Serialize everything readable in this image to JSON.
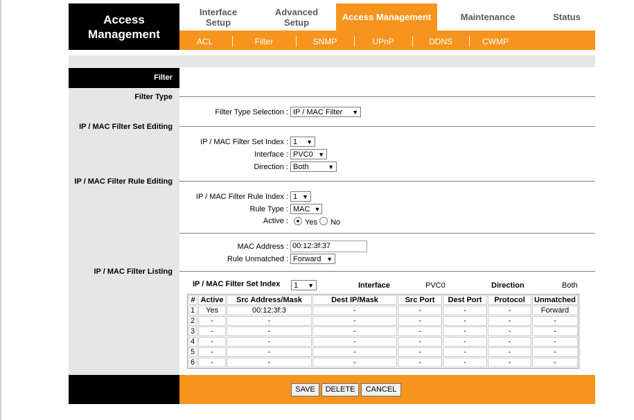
{
  "brand": {
    "line1": "Access",
    "line2": "Management"
  },
  "top_tabs": [
    {
      "line1": "Interface",
      "line2": "Setup"
    },
    {
      "line1": "Advanced",
      "line2": "Setup"
    },
    {
      "line1": "Access Management",
      "line2": ""
    },
    {
      "line1": "Maintenance",
      "line2": ""
    },
    {
      "line1": "Status",
      "line2": ""
    }
  ],
  "sub_tabs": [
    "ACL",
    "Filter",
    "SNMP",
    "UPnP",
    "DDNS",
    "CWMP"
  ],
  "left": {
    "header": "Filter",
    "filter_type": "Filter Type",
    "set_editing": "IP / MAC Filter Set Editing",
    "rule_editing": "IP / MAC Filter Rule Editing",
    "listing": "IP / MAC Filter Listing"
  },
  "form": {
    "filter_type_selection_label": "Filter Type Selection :",
    "filter_type_selection_value": "IP / MAC Filter",
    "set_index_label": "IP / MAC Filter Set Index :",
    "set_index_value": "1",
    "interface_label": "Interface :",
    "interface_value": "PVC0",
    "direction_label": "Direction :",
    "direction_value": "Both",
    "rule_index_label": "IP / MAC Filter Rule Index :",
    "rule_index_value": "1",
    "rule_type_label": "Rule Type :",
    "rule_type_value": "MAC",
    "active_label": "Active :",
    "active_yes": "Yes",
    "active_no": "No",
    "mac_label": "MAC Address :",
    "mac_value": "00:12:3f:37",
    "unmatched_label": "Rule Unmatched :",
    "unmatched_value": "Forward"
  },
  "listing": {
    "set_index_label": "IP / MAC Filter Set Index",
    "set_index_value": "1",
    "interface_label": "Interface",
    "interface_value": "PVC0",
    "direction_label": "Direction",
    "direction_value": "Both",
    "columns": [
      "#",
      "Active",
      "Src Address/Mask",
      "Dest IP/Mask",
      "Src Port",
      "Dest Port",
      "Protocol",
      "Unmatched"
    ],
    "rows": [
      [
        "1",
        "Yes",
        "00:12:3f:3",
        "-",
        "-",
        "-",
        "-",
        "Forward"
      ],
      [
        "2",
        "-",
        "-",
        "-",
        "-",
        "-",
        "-",
        "-"
      ],
      [
        "3",
        "-",
        "-",
        "-",
        "-",
        "-",
        "-",
        "-"
      ],
      [
        "4",
        "-",
        "-",
        "-",
        "-",
        "-",
        "-",
        "-"
      ],
      [
        "5",
        "-",
        "-",
        "-",
        "-",
        "-",
        "-",
        "-"
      ],
      [
        "6",
        "-",
        "-",
        "-",
        "-",
        "-",
        "-",
        "-"
      ]
    ]
  },
  "buttons": {
    "save": "SAVE",
    "delete": "DELETE",
    "cancel": "CANCEL"
  },
  "icons": {
    "dropdown": "dropdown-arrow-icon"
  },
  "colors": {
    "accent": "#f7941d",
    "header_bg": "#000000",
    "panel_bg": "#e6e6e6"
  }
}
